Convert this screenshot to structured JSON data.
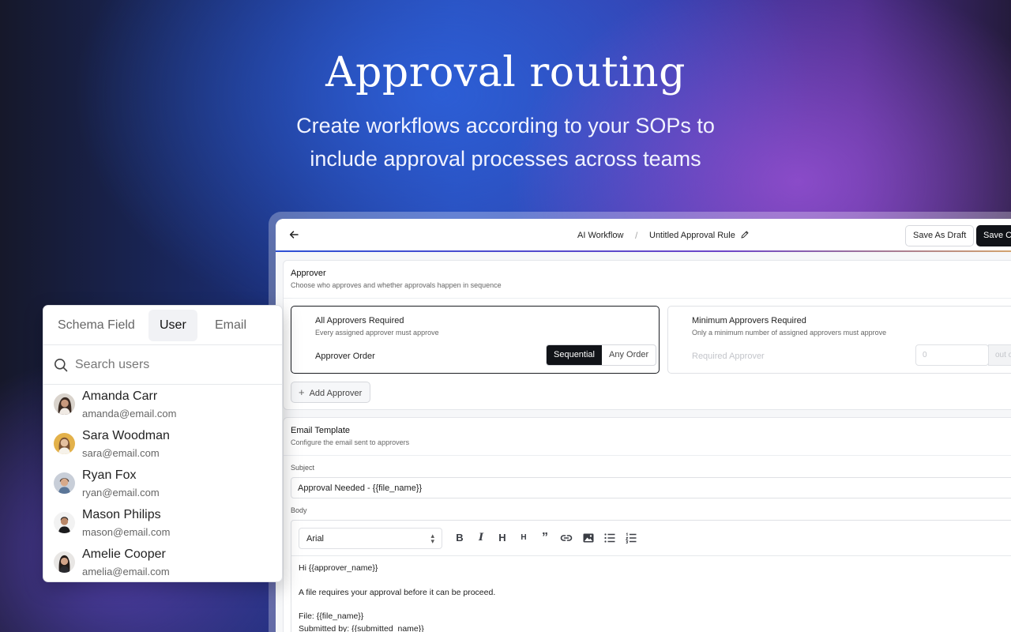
{
  "hero": {
    "title": "Approval routing",
    "subtitle_line1": "Create workflows according to your SOPs to",
    "subtitle_line2": "include approval processes across teams"
  },
  "topbar": {
    "breadcrumb_parent": "AI Workflow",
    "breadcrumb_sep": "/",
    "breadcrumb_current": "Untitled Approval Rule",
    "save_draft_label": "Save As Draft",
    "save_changes_label": "Save Ch"
  },
  "approver": {
    "title": "Approver",
    "description": "Choose who approves and whether approvals happen in sequence",
    "all_required": {
      "title": "All Approvers Required",
      "description": "Every assigned approver must approve",
      "order_label": "Approver Order",
      "order_options": [
        "Sequential",
        "Any Order"
      ],
      "selected": "Sequential"
    },
    "minimum_required": {
      "title": "Minimum Approvers Required",
      "description": "Only a minimum number of assigned approvers must approve",
      "required_label": "Required Approver",
      "required_value": "0",
      "suffix": "out o"
    },
    "add_label": "Add Approver"
  },
  "email": {
    "title": "Email Template",
    "description": "Configure the email sent to approvers",
    "subject_label": "Subject",
    "subject_value": "Approval Needed -  {{file_name}}",
    "body_label": "Body",
    "font": "Arial",
    "body_lines": [
      "Hi {{approver_name}}",
      "A file requires your approval before it can be proceed.",
      "File: {{file_name}}",
      "Submitted by: {{submitted_name}}"
    ]
  },
  "picker": {
    "tabs": [
      "Schema Field",
      "User",
      "Email"
    ],
    "active_tab": "User",
    "search_placeholder": "Search users",
    "users": [
      {
        "name": "Amanda Carr",
        "email": "amanda@email.com"
      },
      {
        "name": "Sara Woodman",
        "email": "sara@email.com"
      },
      {
        "name": "Ryan Fox",
        "email": "ryan@email.com"
      },
      {
        "name": "Mason Philips",
        "email": "mason@email.com"
      },
      {
        "name": "Amelie Cooper",
        "email": "amelia@email.com"
      }
    ]
  },
  "colors": {
    "accent_dark": "#111318",
    "border": "#dfe1e5",
    "hero_text": "#ffffff"
  }
}
